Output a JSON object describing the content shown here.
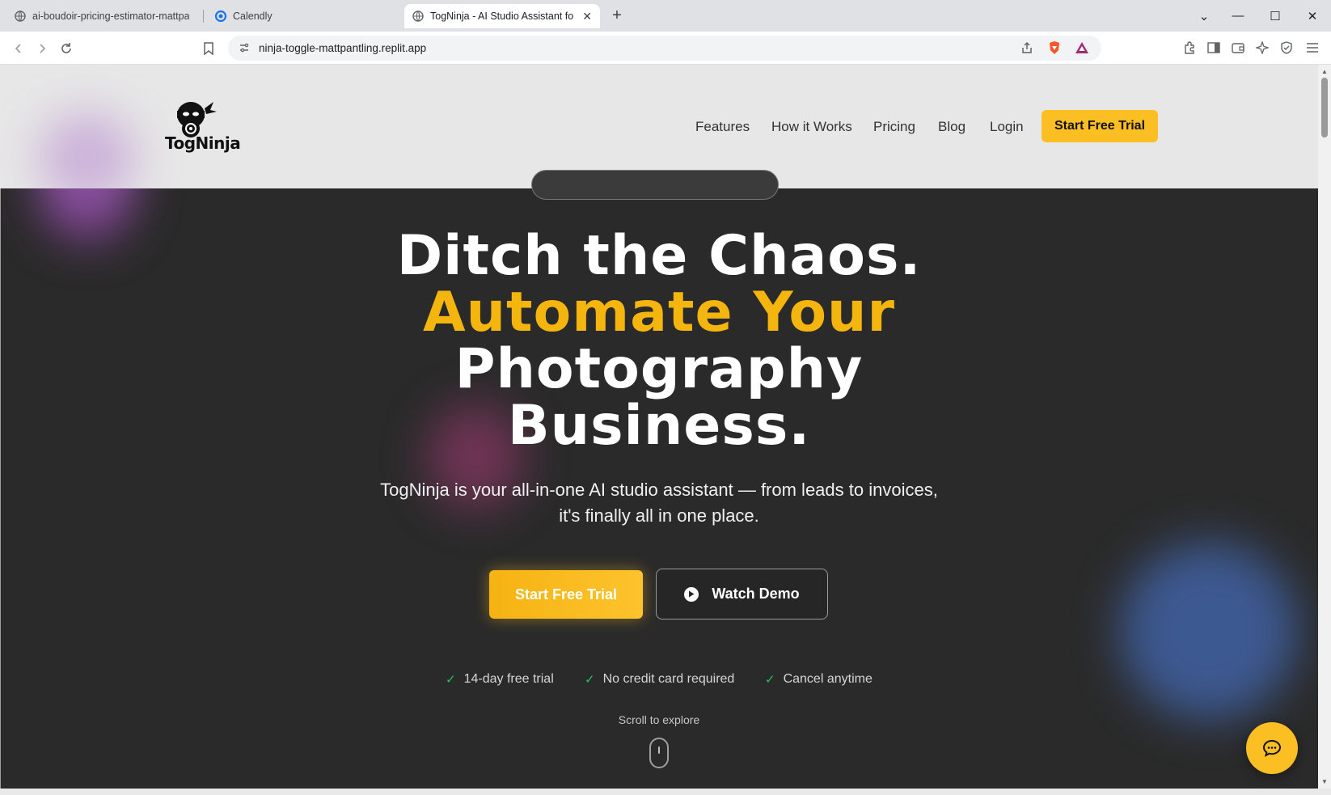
{
  "browser": {
    "tabs": [
      {
        "label": "ai-boudoir-pricing-estimator-mattpa",
        "icon": "globe-icon",
        "active": false
      },
      {
        "label": "Calendly",
        "icon": "calendly-icon",
        "active": false
      },
      {
        "label": "TogNinja - AI Studio Assistant fo",
        "icon": "globe-icon",
        "active": true
      }
    ],
    "new_tab": "+",
    "address_bar": {
      "url": "ninja-toggle-mattpantling.replit.app"
    },
    "window_controls": {
      "minimize": "—",
      "maximize": "☐",
      "close": "✕",
      "tab_search": "⌄"
    }
  },
  "site": {
    "logo_text": "TogNinja",
    "nav": [
      {
        "label": "Features"
      },
      {
        "label": "How it Works"
      },
      {
        "label": "Pricing"
      },
      {
        "label": "Blog"
      },
      {
        "label": "Login"
      }
    ],
    "nav_cta": "Start Free Trial",
    "hero": {
      "title_line1": "Ditch the Chaos.",
      "title_line2": "Automate Your",
      "title_line3": "Photography",
      "title_line4": "Business.",
      "subtitle_line1": "TogNinja is your all-in-one AI studio assistant — from leads to invoices,",
      "subtitle_line2": "it's finally all in one place.",
      "primary_cta": "Start Free Trial",
      "secondary_cta": "Watch Demo",
      "perks": [
        "14-day free trial",
        "No credit card required",
        "Cancel anytime"
      ],
      "scroll_hint": "Scroll to explore"
    }
  },
  "colors": {
    "accent": "#fbbf24",
    "gold_text": "#f5b50f",
    "hero_bg": "#2a2a2a",
    "header_bg": "#e7e7e7",
    "check": "#22c55e"
  }
}
